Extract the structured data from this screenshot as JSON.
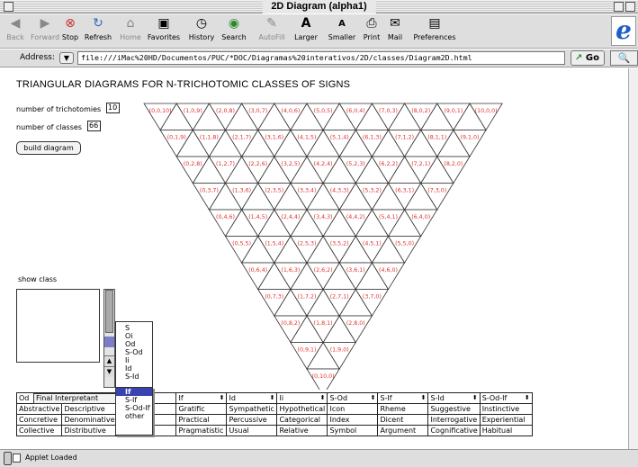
{
  "window": {
    "title": "2D Diagram (alpha1)"
  },
  "toolbar": {
    "back": "Back",
    "forward": "Forward",
    "stop": "Stop",
    "refresh": "Refresh",
    "home": "Home",
    "favorites": "Favorites",
    "history": "History",
    "search": "Search",
    "autofill": "AutoFill",
    "larger": "Larger",
    "smaller": "Smaller",
    "print": "Print",
    "mail": "Mail",
    "preferences": "Preferences"
  },
  "address": {
    "label": "Address:",
    "url": "file:///iMac%20HD/Documentos/PUC/*DOC/Diagramas%20interativos/2D/classes/Diagram2D.html",
    "go": "Go"
  },
  "page": {
    "heading": "TRIANGULAR DIAGRAMS FOR N-TRICHOTOMIC CLASSES OF SIGNS",
    "trichotomies_label": "number of trichotomies",
    "trichotomies_value": "10",
    "classes_label": "number of classes",
    "classes_value": "66",
    "build_button": "build diagram",
    "show_class_label": "show class"
  },
  "diagram": {
    "rows": [
      [
        "0,0,10",
        "1,0,9",
        "2,0,8",
        "3,0,7",
        "4,0,6",
        "5,0,5",
        "6,0,4",
        "7,0,3",
        "8,0,2",
        "9,0,1",
        "10,0,0"
      ],
      [
        "0,1,9",
        "1,1,8",
        "2,1,7",
        "3,1,6",
        "4,1,5",
        "5,1,4",
        "6,1,3",
        "7,1,2",
        "8,1,1",
        "9,1,0"
      ],
      [
        "0,2,8",
        "1,2,7",
        "2,2,6",
        "3,2,5",
        "4,2,4",
        "5,2,3",
        "6,2,2",
        "7,2,1",
        "8,2,0"
      ],
      [
        "0,3,7",
        "1,3,6",
        "2,3,5",
        "3,3,4",
        "4,3,3",
        "5,3,2",
        "6,3,1",
        "7,3,0"
      ],
      [
        "0,4,6",
        "1,4,5",
        "2,4,4",
        "3,4,3",
        "4,4,2",
        "5,4,1",
        "6,4,0"
      ],
      [
        "0,5,5",
        "1,5,4",
        "2,5,3",
        "3,5,2",
        "4,5,1",
        "5,5,0"
      ],
      [
        "0,6,4",
        "1,6,3",
        "2,6,2",
        "3,6,1",
        "4,6,0"
      ],
      [
        "0,7,3",
        "1,7,2",
        "2,7,1",
        "3,7,0"
      ],
      [
        "0,8,2",
        "1,8,1",
        "2,8,0"
      ],
      [
        "0,9,1",
        "1,9,0"
      ],
      [
        "0,10,0"
      ]
    ],
    "label_color": "#e03030"
  },
  "dropdown": {
    "items_above": [
      "S",
      "Oi",
      "Od",
      "S-Od",
      "Ii",
      "Id",
      "S-Id"
    ],
    "selected": "If",
    "items_below": [
      "S-If",
      "S-Od-If",
      "other"
    ],
    "current_label": "Final Interpretant"
  },
  "table": {
    "headers": [
      "Od",
      "Final Interpretant",
      "If",
      "Id",
      "Ii",
      "S-Od",
      "S-If",
      "S-Id",
      "S-Od-If"
    ],
    "rows": [
      [
        "Abstractive",
        "Descriptive",
        "",
        "Gratific",
        "Sympathetic",
        "Hypothetical",
        "Icon",
        "Rheme",
        "Suggestive",
        "Instinctive"
      ],
      [
        "Concretive",
        "Denominative",
        "",
        "Practical",
        "Percussive",
        "Categorical",
        "Index",
        "Dicent",
        "Interrogative",
        "Experiential"
      ],
      [
        "Collective",
        "Distributive",
        "",
        "Pragmatistic",
        "Usual",
        "Relative",
        "Symbol",
        "Argument",
        "Cognificative",
        "Habitual"
      ]
    ]
  },
  "status": {
    "text": "Applet Loaded"
  }
}
